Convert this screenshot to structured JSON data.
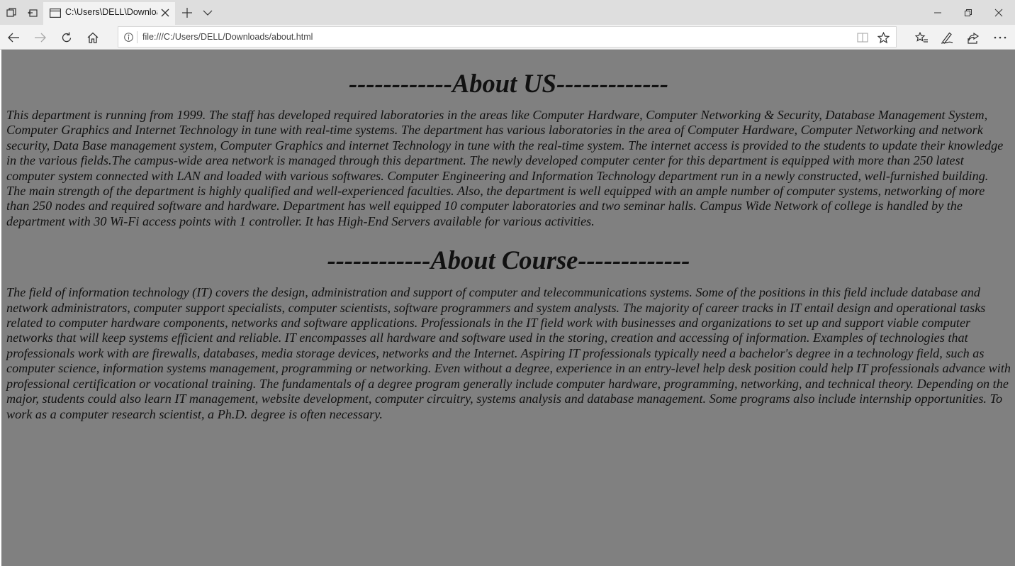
{
  "browser": {
    "tab": {
      "title": "C:\\Users\\DELL\\Downloa"
    },
    "address": {
      "url": "file:///C:/Users/DELL/Downloads/about.html"
    }
  },
  "page": {
    "about_us": {
      "heading": "------------About US-------------",
      "text": "This department is running from 1999. The staff has developed required laboratories in the areas like Computer Hardware, Computer Networking & Security, Database Management System, Computer Graphics and Internet Technology in tune with real-time systems. The department has various laboratories in the area of Computer Hardware, Computer Networking and network security, Data Base management system, Computer Graphics and internet Technology in tune with the real-time system. The internet access is provided to the students to update their knowledge in the various fields.The campus-wide area network is managed through this department. The newly developed computer center for this department is equipped with more than 250 latest computer system connected with LAN and loaded with various softwares. Computer Engineering and Information Technology department run in a newly constructed, well-furnished building. The main strength of the department is highly qualified and well-experienced faculties. Also, the department is well equipped with an ample number of computer systems, networking of more than 250 nodes and required software and hardware. Department has well equipped 10 computer laboratories and two seminar halls. Campus Wide Network of college is handled by the department with 30 Wi-Fi access points with 1 controller. It has High-End Servers available for various activities."
    },
    "about_course": {
      "heading": "------------About Course-------------",
      "text": "The field of information technology (IT) covers the design, administration and support of computer and telecommunications systems. Some of the positions in this field include database and network administrators, computer support specialists, computer scientists, software programmers and system analysts. The majority of career tracks in IT entail design and operational tasks related to computer hardware components, networks and software applications. Professionals in the IT field work with businesses and organizations to set up and support viable computer networks that will keep systems efficient and reliable. IT encompasses all hardware and software used in the storing, creation and accessing of information. Examples of technologies that professionals work with are firewalls, databases, media storage devices, networks and the Internet. Aspiring IT professionals typically need a bachelor's degree in a technology field, such as computer science, information systems management, programming or networking. Even without a degree, experience in an entry-level help desk position could help IT professionals advance with professional certification or vocational training. The fundamentals of a degree program generally include computer hardware, programming, networking, and technical theory. Depending on the major, students could also learn IT management, website development, computer circuitry, systems analysis and database management. Some programs also include internship opportunities. To work as a computer research scientist, a Ph.D. degree is often necessary."
    },
    "background_color": "#808080"
  },
  "icons": {
    "set_aside_tabs": "tabs-aside-icon",
    "restore_tabs": "tabs-restore-icon",
    "tab_favicon": "page-icon",
    "tab_close": "close-icon",
    "new_tab": "plus-icon",
    "tab_list": "chevron-down-icon",
    "minimize": "minimize-icon",
    "maximize": "restore-icon",
    "close_window": "close-icon",
    "back": "arrow-left-icon",
    "forward": "arrow-right-icon",
    "refresh": "refresh-icon",
    "home": "home-icon",
    "site_info": "info-icon",
    "reading_view": "book-icon",
    "favorite": "star-icon",
    "favorites_hub": "star-list-icon",
    "web_note": "pen-icon",
    "share": "share-icon",
    "more": "ellipsis-icon"
  }
}
